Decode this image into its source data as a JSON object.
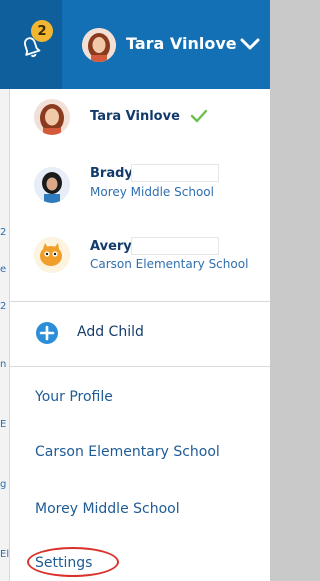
{
  "header": {
    "notification_count": "2",
    "account_name": "Tara Vinlove",
    "icons": [
      "bell-icon",
      "chevron-down-icon",
      "avatar"
    ]
  },
  "sidebar_strip": {
    "glyphs": [
      "2",
      "e",
      "2",
      "n",
      "E",
      "g",
      "El"
    ]
  },
  "dropdown": {
    "accounts": [
      {
        "name": "Tara Vinlove",
        "school": "",
        "selected": true
      },
      {
        "name": "Brady",
        "school": "Morey Middle School",
        "selected": false
      },
      {
        "name": "Avery",
        "school": "Carson Elementary School",
        "selected": false
      }
    ],
    "add_child_label": "Add Child",
    "links": [
      "Your Profile",
      "Carson Elementary School",
      "Morey Middle School",
      "Settings"
    ]
  },
  "colors": {
    "header_blue": "#1470b5",
    "accent_blue": "#2b8ed9",
    "badge_yellow": "#f2b632",
    "check_green": "#6cc04a",
    "highlight_red": "#d9322c"
  }
}
